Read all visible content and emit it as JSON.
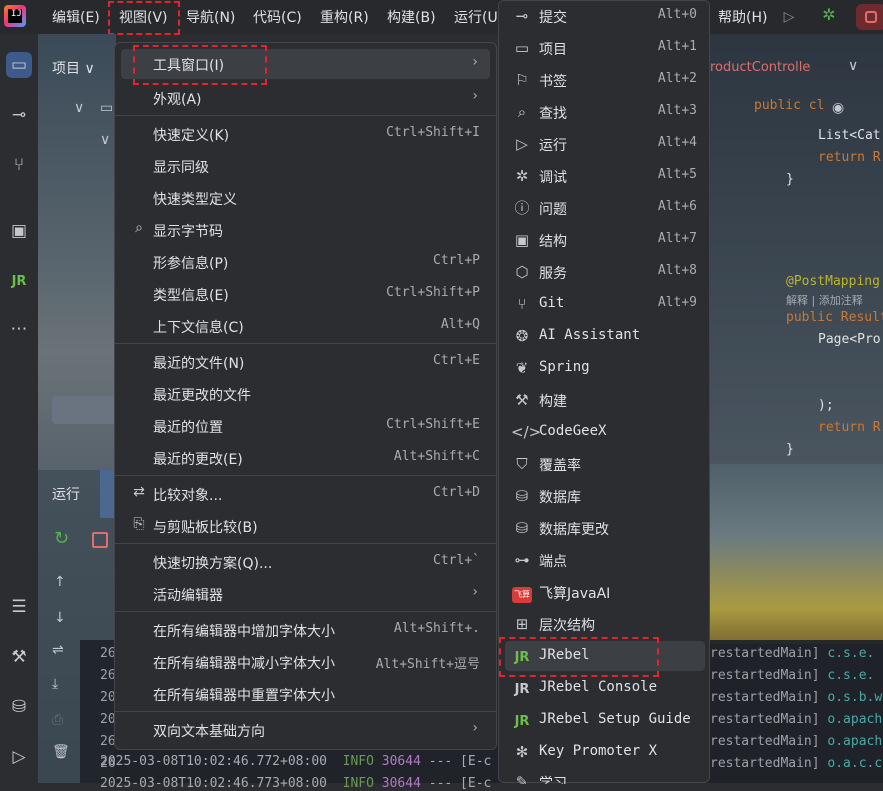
{
  "menubar": {
    "items": [
      "编辑(E)",
      "视图(V)",
      "导航(N)",
      "代码(C)",
      "重构(R)",
      "构建(B)",
      "运行(U",
      "帮助(H)"
    ]
  },
  "project_panel": {
    "title": "项目 ∨"
  },
  "run_panel": {
    "title": "运行"
  },
  "editor": {
    "tab": "roductControlle",
    "lines": [
      "public cl",
      "List<Cat",
      "return R",
      "}",
      "@PostMapping",
      "解释 | 添加注释",
      "public Result",
      "Page<Pro",
      ");",
      "return R",
      "}"
    ]
  },
  "console": {
    "lines": [
      {
        "time": "26",
        "thread": "restartedMain]",
        "logger": "c.s.e."
      },
      {
        "time": "26",
        "thread": "restartedMain]",
        "logger": "c.s.e."
      },
      {
        "time": "20",
        "thread": "restartedMain]",
        "logger": "o.s.b.w"
      },
      {
        "time": "20",
        "thread": "restartedMain]",
        "logger": "o.apach"
      },
      {
        "time": "26",
        "thread": "restartedMain]",
        "logger": "o.apach"
      },
      {
        "time": "26",
        "thread": "restartedMain]",
        "logger": "o.a.c.c"
      },
      {
        "time": "2025-03-08T10:02:46.772+08:00",
        "level": "INFO",
        "pid": "30644",
        "rest": "--- [E-c"
      },
      {
        "time": "2025-03-08T10:02:46.773+08:00",
        "level": "INFO",
        "pid": "30644",
        "rest": "--- [E-c"
      }
    ]
  },
  "view_menu": {
    "items": [
      {
        "label": "工具窗口(I)",
        "shortcut": "",
        "submenu": true
      },
      {
        "label": "外观(A)",
        "shortcut": "",
        "submenu": true
      },
      {
        "label": "快速定义(K)",
        "shortcut": "Ctrl+Shift+I"
      },
      {
        "label": "显示同级",
        "shortcut": ""
      },
      {
        "label": "快速类型定义",
        "shortcut": ""
      },
      {
        "label": "显示字节码",
        "shortcut": "",
        "icon": "bytecode-icon"
      },
      {
        "label": "形参信息(P)",
        "shortcut": "Ctrl+P"
      },
      {
        "label": "类型信息(E)",
        "shortcut": "Ctrl+Shift+P"
      },
      {
        "label": "上下文信息(C)",
        "shortcut": "Alt+Q"
      },
      {
        "label": "最近的文件(N)",
        "shortcut": "Ctrl+E"
      },
      {
        "label": "最近更改的文件",
        "shortcut": ""
      },
      {
        "label": "最近的位置",
        "shortcut": "Ctrl+Shift+E"
      },
      {
        "label": "最近的更改(E)",
        "shortcut": "Alt+Shift+C"
      },
      {
        "label": "比较对象...",
        "shortcut": "Ctrl+D",
        "icon": "compare-icon"
      },
      {
        "label": "与剪贴板比较(B)",
        "shortcut": "",
        "icon": "clipboard-compare-icon"
      },
      {
        "label": "快速切换方案(Q)...",
        "shortcut": "Ctrl+`"
      },
      {
        "label": "活动编辑器",
        "shortcut": "",
        "submenu": true
      },
      {
        "label": "在所有编辑器中增加字体大小",
        "shortcut": "Alt+Shift+."
      },
      {
        "label": "在所有编辑器中减小字体大小",
        "shortcut": "Alt+Shift+逗号"
      },
      {
        "label": "在所有编辑器中重置字体大小",
        "shortcut": ""
      },
      {
        "label": "双向文本基础方向",
        "shortcut": "",
        "submenu": true
      }
    ]
  },
  "tool_windows_menu": {
    "items": [
      {
        "label": "提交",
        "shortcut": "Alt+0",
        "icon": "commit-icon"
      },
      {
        "label": "项目",
        "shortcut": "Alt+1",
        "icon": "folder-icon"
      },
      {
        "label": "书签",
        "shortcut": "Alt+2",
        "icon": "bookmark-icon"
      },
      {
        "label": "查找",
        "shortcut": "Alt+3",
        "icon": "search-icon"
      },
      {
        "label": "运行",
        "shortcut": "Alt+4",
        "icon": "run-icon"
      },
      {
        "label": "调试",
        "shortcut": "Alt+5",
        "icon": "debug-bug-icon"
      },
      {
        "label": "问题",
        "shortcut": "Alt+6",
        "icon": "problems-icon"
      },
      {
        "label": "结构",
        "shortcut": "Alt+7",
        "icon": "structure-icon"
      },
      {
        "label": "服务",
        "shortcut": "Alt+8",
        "icon": "services-icon"
      },
      {
        "label": "Git",
        "shortcut": "Alt+9",
        "icon": "git-branch-icon"
      },
      {
        "label": "AI Assistant",
        "shortcut": "",
        "icon": "ai-assistant-icon"
      },
      {
        "label": "Spring",
        "shortcut": "",
        "icon": "spring-leaf-icon"
      },
      {
        "label": "构建",
        "shortcut": "",
        "icon": "hammer-icon"
      },
      {
        "label": "CodeGeeX",
        "shortcut": "",
        "icon": "codegeex-icon"
      },
      {
        "label": "覆盖率",
        "shortcut": "",
        "icon": "coverage-shield-icon"
      },
      {
        "label": "数据库",
        "shortcut": "",
        "icon": "database-icon"
      },
      {
        "label": "数据库更改",
        "shortcut": "",
        "icon": "database-changes-icon"
      },
      {
        "label": "端点",
        "shortcut": "",
        "icon": "endpoints-icon"
      },
      {
        "label": "飞算JavaAI",
        "shortcut": "",
        "icon": "feisuan-badge-icon"
      },
      {
        "label": "层次结构",
        "shortcut": "",
        "icon": "hierarchy-icon"
      },
      {
        "label": "JRebel",
        "shortcut": "",
        "icon": "jrebel-icon"
      },
      {
        "label": "JRebel Console",
        "shortcut": "",
        "icon": "jrebel-console-icon"
      },
      {
        "label": "JRebel Setup Guide",
        "shortcut": "",
        "icon": "jrebel-setup-icon"
      },
      {
        "label": "Key Promoter X",
        "shortcut": "",
        "icon": "key-promoter-icon"
      },
      {
        "label": "学习",
        "shortcut": "",
        "icon": "learn-icon"
      }
    ]
  },
  "colors": {
    "highlight_border": "#e2242c",
    "menu_bg": "#2b2d30",
    "selection_bg": "#3c3f44"
  }
}
